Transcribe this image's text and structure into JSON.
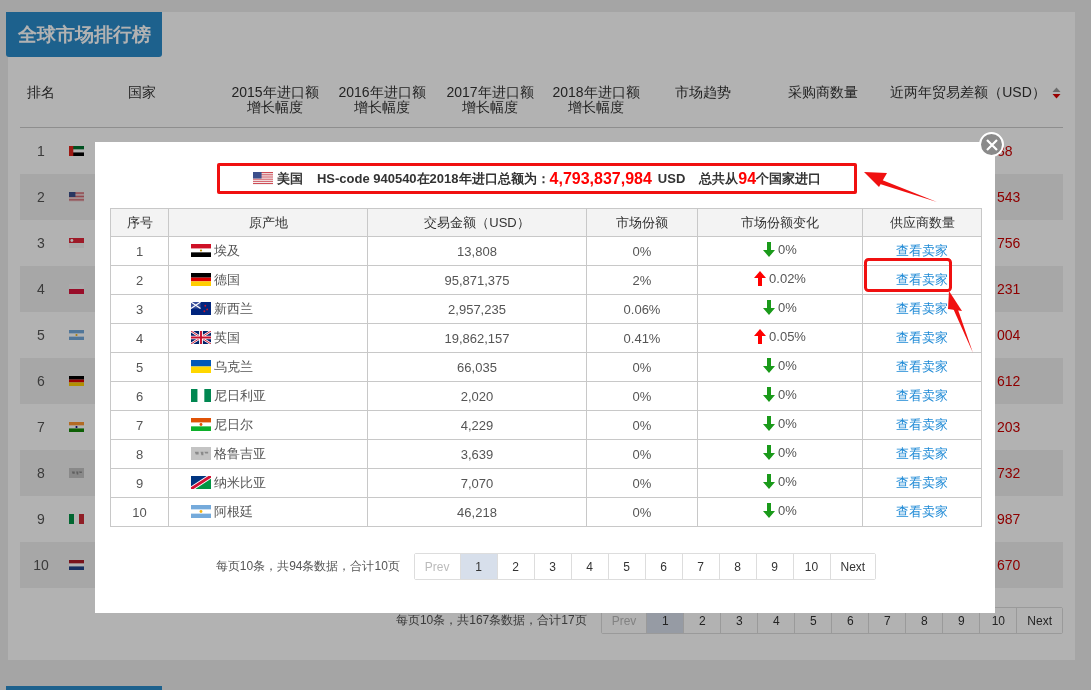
{
  "background": {
    "title": "全球市场排行榜",
    "columns": [
      {
        "label": "排名"
      },
      {
        "label": "国家"
      },
      {
        "label": "2015年进口额增长幅度"
      },
      {
        "label": "2016年进口额增长幅度"
      },
      {
        "label": "2017年进口额增长幅度"
      },
      {
        "label": "2018年进口额增长幅度"
      },
      {
        "label": "市场趋势"
      },
      {
        "label": "采购商数量"
      },
      {
        "label": "近两年贸易差额（USD）",
        "sorted_descending": true
      }
    ],
    "rows": [
      {
        "rank": "1",
        "flag": {
          "kind": "ae"
        },
        "difference": "38"
      },
      {
        "rank": "2",
        "flag": {
          "kind": "us"
        },
        "difference": "543"
      },
      {
        "rank": "3",
        "flag": {
          "kind": "sg"
        },
        "difference": "756"
      },
      {
        "rank": "4",
        "flag": {
          "kind": "pl"
        },
        "difference": "231"
      },
      {
        "rank": "5",
        "flag": {
          "kind": "ar"
        },
        "difference": "004"
      },
      {
        "rank": "6",
        "flag": {
          "kind": "de"
        },
        "difference": "612"
      },
      {
        "rank": "7",
        "flag": {
          "kind": "in"
        },
        "difference": "203"
      },
      {
        "rank": "8",
        "flag": {
          "kind": "none"
        },
        "difference": "732"
      },
      {
        "rank": "9",
        "flag": {
          "kind": "it"
        },
        "difference": "987"
      },
      {
        "rank": "10",
        "flag": {
          "kind": "nl"
        },
        "difference": "670"
      }
    ],
    "pagination": {
      "info": "每页10条，共167条数据，合计17页",
      "prev": {
        "label": "Prev",
        "disabled": true
      },
      "pages": [
        {
          "label": "1",
          "selected": true
        },
        {
          "label": "2",
          "selected": false
        },
        {
          "label": "3",
          "selected": false
        },
        {
          "label": "4",
          "selected": false
        },
        {
          "label": "5",
          "selected": false
        },
        {
          "label": "6",
          "selected": false
        },
        {
          "label": "7",
          "selected": false
        },
        {
          "label": "8",
          "selected": false
        },
        {
          "label": "9",
          "selected": false
        },
        {
          "label": "10",
          "selected": false
        }
      ],
      "next": {
        "label": "Next",
        "disabled": false
      }
    }
  },
  "modal": {
    "summary": {
      "flag": {
        "kind": "us"
      },
      "country": "美国",
      "text": "HS-code 940540在2018年进口总额为：",
      "amount": "4,793,837,984",
      "unit": "USD",
      "count_prefix": "总共从",
      "count": "94",
      "count_suffix": "个国家进口"
    },
    "columns": [
      "序号",
      "原产地",
      "交易金额（USD）",
      "市场份额",
      "市场份额变化",
      "供应商数量"
    ],
    "rows": [
      {
        "index": "1",
        "flag": {
          "kind": "eg"
        },
        "origin": "埃及",
        "amount": "13,808",
        "share": "0%",
        "rising": false,
        "change": "0%",
        "link": "查看卖家"
      },
      {
        "index": "2",
        "flag": {
          "kind": "de"
        },
        "origin": "德国",
        "amount": "95,871,375",
        "share": "2%",
        "rising": true,
        "change": "0.02%",
        "link": "查看卖家"
      },
      {
        "index": "3",
        "flag": {
          "kind": "nz"
        },
        "origin": "新西兰",
        "amount": "2,957,235",
        "share": "0.06%",
        "rising": false,
        "change": "0%",
        "link": "查看卖家"
      },
      {
        "index": "4",
        "flag": {
          "kind": "gb"
        },
        "origin": "英国",
        "amount": "19,862,157",
        "share": "0.41%",
        "rising": true,
        "change": "0.05%",
        "link": "查看卖家"
      },
      {
        "index": "5",
        "flag": {
          "kind": "ua"
        },
        "origin": "乌克兰",
        "amount": "66,035",
        "share": "0%",
        "rising": false,
        "change": "0%",
        "link": "查看卖家"
      },
      {
        "index": "6",
        "flag": {
          "kind": "ng"
        },
        "origin": "尼日利亚",
        "amount": "2,020",
        "share": "0%",
        "rising": false,
        "change": "0%",
        "link": "查看卖家"
      },
      {
        "index": "7",
        "flag": {
          "kind": "ne"
        },
        "origin": "尼日尔",
        "amount": "4,229",
        "share": "0%",
        "rising": false,
        "change": "0%",
        "link": "查看卖家"
      },
      {
        "index": "8",
        "flag": {
          "kind": "none"
        },
        "origin": "格鲁吉亚",
        "amount": "3,639",
        "share": "0%",
        "rising": false,
        "change": "0%",
        "link": "查看卖家"
      },
      {
        "index": "9",
        "flag": {
          "kind": "na"
        },
        "origin": "纳米比亚",
        "amount": "7,070",
        "share": "0%",
        "rising": false,
        "change": "0%",
        "link": "查看卖家"
      },
      {
        "index": "10",
        "flag": {
          "kind": "ar"
        },
        "origin": "阿根廷",
        "amount": "46,218",
        "share": "0%",
        "rising": false,
        "change": "0%",
        "link": "查看卖家"
      }
    ],
    "pagination": {
      "info": "每页10条，共94条数据，合计10页",
      "prev": {
        "label": "Prev",
        "disabled": true
      },
      "pages": [
        {
          "label": "1",
          "selected": true
        },
        {
          "label": "2",
          "selected": false
        },
        {
          "label": "3",
          "selected": false
        },
        {
          "label": "4",
          "selected": false
        },
        {
          "label": "5",
          "selected": false
        },
        {
          "label": "6",
          "selected": false
        },
        {
          "label": "7",
          "selected": false
        },
        {
          "label": "8",
          "selected": false
        },
        {
          "label": "9",
          "selected": false
        },
        {
          "label": "10",
          "selected": false
        }
      ],
      "next": {
        "label": "Next",
        "disabled": false
      }
    }
  }
}
